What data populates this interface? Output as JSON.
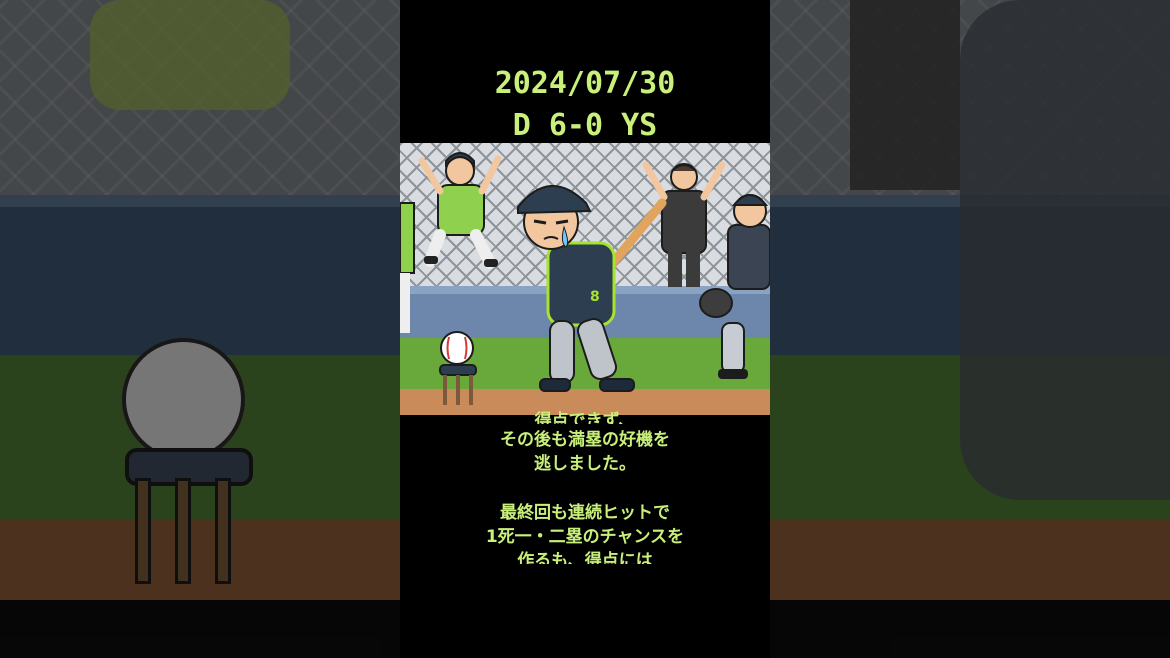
{
  "video": {
    "title_date": "2024/07/30",
    "title_score": "D 6-0 YS"
  },
  "subtitles": [
    "得点できず、",
    "その後も満塁の好機を",
    "逃しました。",
    "最終回も連続ヒットで",
    "1死一・二塁のチャンスを",
    "作るも、得点には"
  ],
  "colors": {
    "text_accent": "#c8f07a",
    "background": "#000000",
    "uniform": "#2c3e50",
    "uniform_trim": "#a6e22e"
  }
}
